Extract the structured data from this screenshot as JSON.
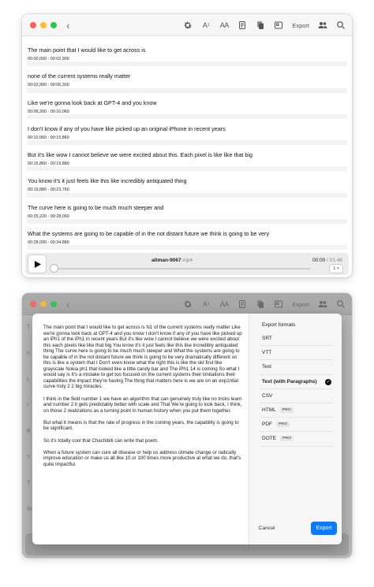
{
  "editor": {
    "toolbar": {
      "text_size_small": "A",
      "text_size_small_sub": "1",
      "text_size_large": "AA",
      "export_label": "Export"
    },
    "segments": [
      {
        "text": "The main point that I would like to get across is",
        "time": "00:00,000 - 00:02,900"
      },
      {
        "text": "none of the current systems really matter",
        "time": "00:02,900 - 00:06,300"
      },
      {
        "text": "Like we're gonna look back at GPT-4 and you know",
        "time": "00:06,300 - 00:10,060"
      },
      {
        "text": "I don't know if any of you have like picked up an original iPhone in recent years",
        "time": "00:10,060 - 00:15,860"
      },
      {
        "text": "But it's like wow I cannot believe we were excited about this. Each pixel is like like that big",
        "time": "00:15,860 - 00:19,880"
      },
      {
        "text": "You know it's it just feels like this like incredibly antiquated thing",
        "time": "00:19,880 - 00:23,760"
      },
      {
        "text": "The curve here is going to be much much steeper and",
        "time": "00:25,220 - 00:28,060"
      },
      {
        "text": "What the systems are going to be capable of in the not distant future we think is going to be very",
        "time": "00:28,000 - 00:34,880"
      }
    ],
    "player": {
      "file_name": "altman-9067",
      "file_ext": ".mp4",
      "current_time": "00:00",
      "total_time": "/ 01:46",
      "progress": 0,
      "speed": "1 ×"
    }
  },
  "export_sheet": {
    "preview_paragraphs": [
      "The main point that I would like to get across is N1 of the current systems really matter Like we're gonna look back at GPT-4 and you know I don't know if any of you have like picked up an iPh1 of the iPh1 in recent years But it's like wow I cannot believe we were excited about this each pixels like like that big You know it's it just feels like this like incredibly antiquated thing The curve here is going to be much much steeper and What the systems are going to be capable of in the not distant future we think is going to be very dramatically different so this is like a system that I Don't even know what the right this is like the old first like grayscale Nokia ph1 that looked like a little candy bar and The iPh1 14 is coming So what I would say is It's a mistake to get too focused on the current systems their limitations their capabilities the impact they're having The thing that matters here is we are on an exp1ntial curve truly 2 2 big miracles.",
      "I think in the field number 1 we have an algorithm that can genuinely truly like no tricks learn and number 2 it gets predictably better with scale and That We're going to look back, I think, on those 2 realizations as a turning point in human history when you put them together.",
      "But what it means is that the rate of progress in the coming years, the capability is going to be significant.",
      "So it's totally cool that Chachibiti can write that poem.",
      "When a future system can cure all disease or help us address climate change or radically improve education or make us all like 10 or 100 times more productive at what we do, that's quite impactful."
    ],
    "title": "Export formats",
    "formats": [
      {
        "label": "SRT",
        "pro": "",
        "selected": false
      },
      {
        "label": "VTT",
        "pro": "",
        "selected": false
      },
      {
        "label": "Text",
        "pro": "",
        "selected": false
      },
      {
        "label": "Text (with Paragraphs)",
        "pro": "",
        "selected": true
      },
      {
        "label": "CSV",
        "pro": "",
        "selected": false
      },
      {
        "label": "HTML",
        "pro": "PRO",
        "selected": false
      },
      {
        "label": "PDF",
        "pro": "PRO",
        "selected": false
      },
      {
        "label": "DOTE",
        "pro": "PRO",
        "selected": false
      }
    ],
    "check_glyph": "✓",
    "cancel_label": "Cancel",
    "export_label": "Export",
    "dim_letters": [
      "T",
      "n",
      "L",
      "I",
      "B",
      "Y",
      "T",
      "W"
    ]
  },
  "colors": {
    "accent": "#0a7aff",
    "close": "#fe5f57",
    "minimize": "#febc2e",
    "zoom": "#28c840"
  },
  "icons": [
    "chevron-left-icon",
    "gear-icon",
    "document-icon",
    "copy-icon",
    "image-icon",
    "people-icon",
    "search-icon",
    "play-icon",
    "checkmark-icon"
  ]
}
